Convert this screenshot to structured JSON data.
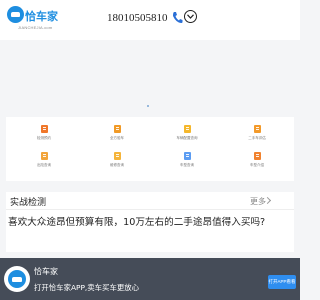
{
  "header": {
    "logo_name": "恰车家",
    "logo_sub": "JIANCHEJIA.com",
    "phone": "18010505810"
  },
  "services": {
    "items": [
      {
        "label": "检测预约",
        "icon": "inspection-booking-icon",
        "color": "#f0772a"
      },
      {
        "label": "全方验车",
        "icon": "full-inspection-icon",
        "color": "#f19a26"
      },
      {
        "label": "车辆配置查询",
        "icon": "config-query-icon",
        "color": "#f5b72c"
      },
      {
        "label": "二手车评估",
        "icon": "used-car-valuation-icon",
        "color": "#f39a2a"
      },
      {
        "label": "出险查询",
        "icon": "accident-query-icon",
        "color": "#f2a43a"
      },
      {
        "label": "维修查询",
        "icon": "repair-query-icon",
        "color": "#f5b43a"
      },
      {
        "label": "车型查询",
        "icon": "model-query-icon",
        "color": "#5b9cf2"
      },
      {
        "label": "车型介绍",
        "icon": "model-intro-icon",
        "color": "#f1822e"
      }
    ]
  },
  "inspection": {
    "title": "实战检测",
    "more": "更多",
    "question": "喜欢大众途昂但预算有限，10万左右的二手途昂值得入买吗?"
  },
  "banner": {
    "name": "恰车家",
    "text": "打开恰车家APP,卖车买车更放心",
    "button": "打开APP看看"
  }
}
